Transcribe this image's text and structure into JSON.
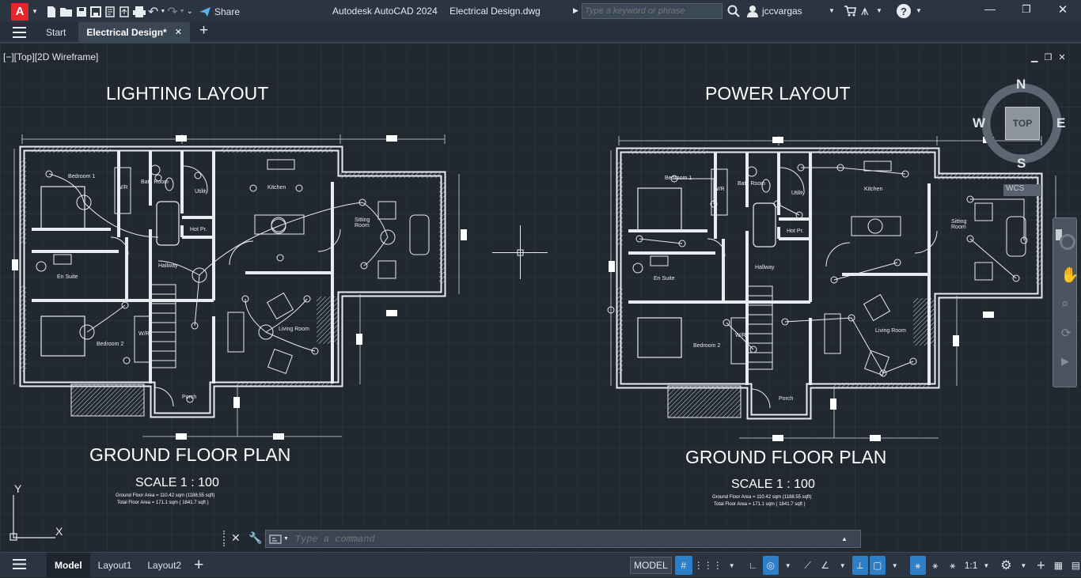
{
  "app": {
    "title": "Autodesk AutoCAD 2024",
    "document": "Electrical Design.dwg",
    "share_label": "Share",
    "logo_letter": "A"
  },
  "search": {
    "placeholder": "Type a keyword or phrase"
  },
  "user": {
    "name": "jccvargas"
  },
  "tabs": [
    {
      "label": "Start"
    },
    {
      "label": "Electrical Design*"
    }
  ],
  "viewport": {
    "label": "[−][Top][2D Wireframe]"
  },
  "drawing": {
    "left": {
      "title": "LIGHTING LAYOUT",
      "subtitle": "GROUND FLOOR PLAN",
      "scale": "SCALE 1 : 100",
      "area1": "Ground Floor Area = 110.42  sqm (1188.55  sqft)",
      "area2": "Total Floor Area = 171.1  sqm ( 1841.7  sqft )"
    },
    "right": {
      "title": "POWER LAYOUT",
      "subtitle": "GROUND FLOOR PLAN",
      "scale": "SCALE 1 : 100",
      "area1": "Ground Floor Area = 110.42  sqm (1188.55  sqft)",
      "area2": "Total Floor Area = 171.1  sqm ( 1841.7  sqft )"
    },
    "rooms_left": [
      "Bedroom 1",
      "Bath Room",
      "Utility",
      "Kitchen",
      "Sitting Room",
      "Hot Pr.",
      "Hallway",
      "En Suite",
      "Bedroom 2",
      "Living Room",
      "W/R",
      "W/R",
      "Porch"
    ],
    "rooms_right": [
      "Bedroom 1",
      "Bath Room",
      "Utility",
      "Kitchen",
      "Sitting Room",
      "Hot Pr.",
      "Hallway",
      "En Suite",
      "Bedroom 2",
      "Living Room",
      "W/R",
      "W/R",
      "Porch"
    ]
  },
  "viewcube": {
    "n": "N",
    "s": "S",
    "e": "E",
    "w": "W",
    "face": "TOP",
    "wcs": "WCS"
  },
  "ucs": {
    "x": "X",
    "y": "Y"
  },
  "command": {
    "placeholder": "Type a command"
  },
  "layout_tabs": [
    {
      "label": "Model"
    },
    {
      "label": "Layout1"
    },
    {
      "label": "Layout2"
    }
  ],
  "status": {
    "model": "MODEL",
    "scale": "1:1"
  }
}
